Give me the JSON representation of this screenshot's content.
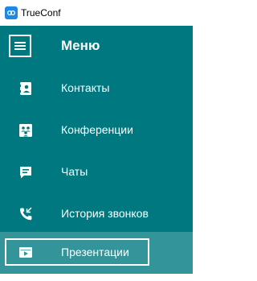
{
  "window": {
    "title": "TrueConf"
  },
  "menu": {
    "title": "Меню",
    "items": [
      {
        "label": "Контакты",
        "icon": "contacts-icon"
      },
      {
        "label": "Конференции",
        "icon": "conferences-icon"
      },
      {
        "label": "Чаты",
        "icon": "chat-icon"
      },
      {
        "label": "История звонков",
        "icon": "call-history-icon"
      },
      {
        "label": "Презентации",
        "icon": "presentation-icon",
        "active": true
      }
    ]
  },
  "colors": {
    "sidebar_bg": "#00787f",
    "active_item_bg": "#33959a",
    "text": "#ffffff",
    "logo": "#1e88e5"
  }
}
